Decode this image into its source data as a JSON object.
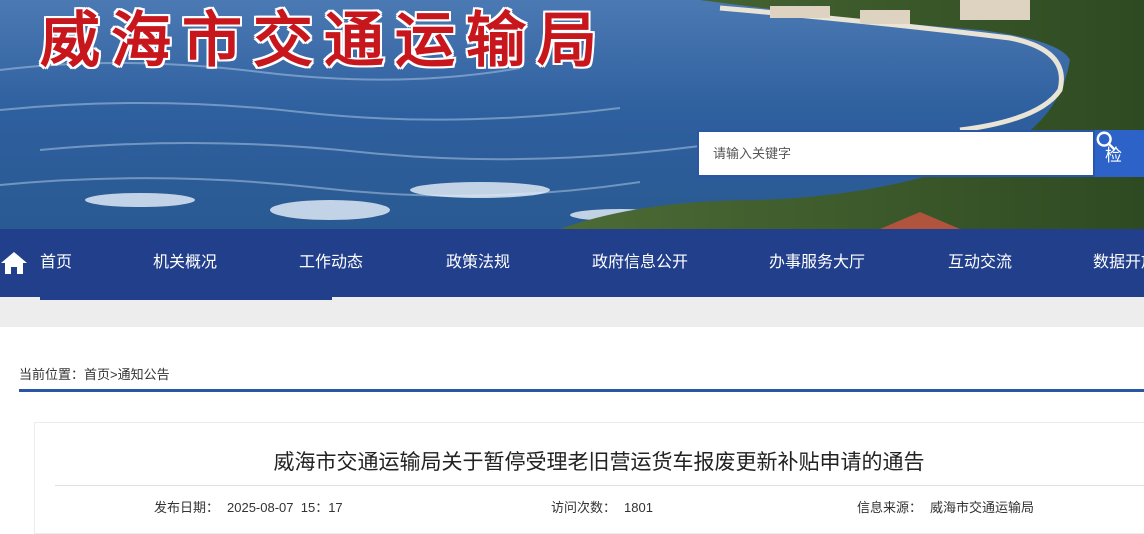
{
  "header": {
    "site_title": "威海市交通运输局",
    "search_placeholder": "请输入关键字",
    "search_button": "检"
  },
  "nav": {
    "items": [
      {
        "label": "首页"
      },
      {
        "label": "机关概况"
      },
      {
        "label": "工作动态"
      },
      {
        "label": "政策法规"
      },
      {
        "label": "政府信息公开"
      },
      {
        "label": "办事服务大厅"
      },
      {
        "label": "互动交流"
      },
      {
        "label": "数据开放"
      }
    ]
  },
  "breadcrumb": {
    "prefix": "当前位置：",
    "home": "首页",
    "separator": ">",
    "current": "通知公告"
  },
  "article": {
    "title": "威海市交通运输局关于暂停受理老旧营运货车报废更新补贴申请的通告",
    "publish_label": "发布日期：",
    "publish_date": "2025-08-07  15：17",
    "views_label": "访问次数：",
    "views": "1801",
    "source_label": "信息来源：",
    "source": "威海市交通运输局"
  },
  "colors": {
    "nav_bg": "#223f8c",
    "title_red": "#c8161d",
    "search_btn": "#2d63c8",
    "accent_rule": "#2a56a8"
  },
  "icons": [
    "home-icon",
    "search-icon"
  ]
}
